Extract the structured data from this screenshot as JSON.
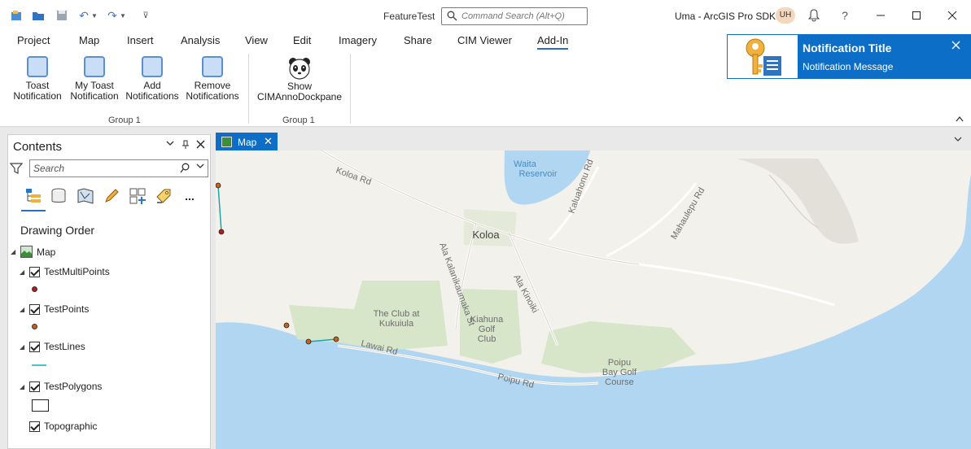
{
  "titlebar": {
    "project_name": "FeatureTest",
    "command_search_placeholder": "Command Search (Alt+Q)",
    "user_info": "Uma - ArcGIS Pro SDK",
    "avatar_initials": "UH",
    "help_label": "?"
  },
  "ribbon_tabs": [
    "Project",
    "Map",
    "Insert",
    "Analysis",
    "View",
    "Edit",
    "Imagery",
    "Share",
    "CIM Viewer",
    "Add-In"
  ],
  "ribbon": {
    "buttons": [
      {
        "line1": "Toast",
        "line2": "Notification"
      },
      {
        "line1": "My Toast",
        "line2": "Notification"
      },
      {
        "line1": "Add",
        "line2": "Notifications"
      },
      {
        "line1": "Remove",
        "line2": "Notifications"
      },
      {
        "line1": "Show",
        "line2": "CIMAnnoDockpane"
      }
    ],
    "groups": [
      "Group 1",
      "Group 1"
    ]
  },
  "notification": {
    "title": "Notification Title",
    "message": "Notification Message"
  },
  "contents": {
    "title": "Contents",
    "search_placeholder": "Search",
    "drawing_order_label": "Drawing Order",
    "more_label": "...",
    "layers": {
      "map": "Map",
      "multipoints": "TestMultiPoints",
      "points": "TestPoints",
      "lines": "TestLines",
      "polygons": "TestPolygons",
      "topographic": "Topographic"
    }
  },
  "map_view": {
    "tab_label": "Map",
    "labels": {
      "koloa": "Koloa",
      "waita_line1": "Waita",
      "waita_line2": "Reservoir",
      "koloa_rd": "Koloa Rd",
      "kaluahonu_rd": "Kaluahonu Rd",
      "mahaulepu_rd": "Mahaulepu Rd",
      "ala_kalanikaumaka": "Ala Kalanikaumaka St",
      "ala_kinoiki": "Ala Kinoiki",
      "club_line1": "The Club at",
      "club_line2": "Kukuiula",
      "kiahuna_line1": "Kiahuna",
      "kiahuna_line2": "Golf",
      "kiahuna_line3": "Club",
      "poipu_bay_line1": "Poipu",
      "poipu_bay_line2": "Bay Golf",
      "poipu_bay_line3": "Course",
      "lawai_rd": "Lawai Rd",
      "poipu_rd": "Poipu Rd"
    }
  },
  "colors": {
    "accent": "#0c6ec7",
    "water": "#b1d6f1",
    "park": "#d7e5c9",
    "land": "#f3f1ec"
  }
}
